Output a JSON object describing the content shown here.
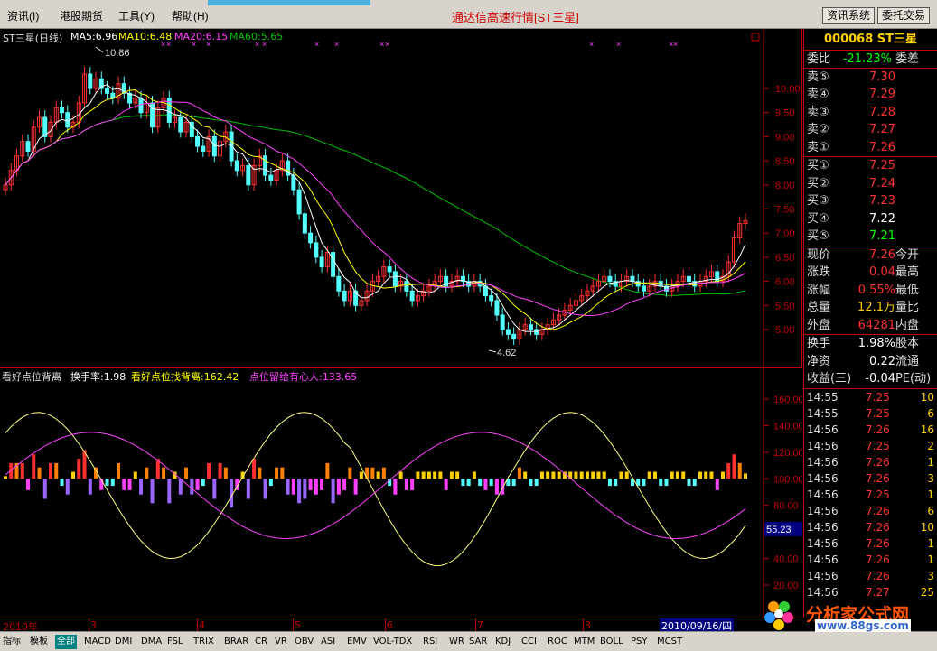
{
  "menubar": {
    "items": [
      "资讯(I)",
      "港股期货",
      "工具(Y)",
      "帮助(H)"
    ],
    "title": "通达信高速行情[ST三星]",
    "btn_news": "资讯系统",
    "btn_trade": "委托交易"
  },
  "main": {
    "legend": {
      "name": "ST三星(日线)",
      "ma5": "MA5:6.96",
      "ma10": "MA10:6.48",
      "ma20": "MA20:6.15",
      "ma60": "MA60:5.65"
    },
    "high_label": "10.86",
    "low_label": "4.62",
    "y_ticks": [
      "10.00",
      "9.50",
      "9.00",
      "8.50",
      "8.00",
      "7.50",
      "7.00",
      "6.50",
      "6.00",
      "5.50",
      "5.00"
    ]
  },
  "indicator": {
    "legend_name": "看好点位背离",
    "legend_turnover": "换手率:1.98",
    "legend_a": "看好点位找背离:162.42",
    "legend_b": "点位留给有心人:133.65",
    "y_ticks": [
      "160.00",
      "140.00",
      "120.00",
      "100.00",
      "80.00",
      "60.00",
      "40.00",
      "20.00"
    ],
    "cursor_value": "55.23"
  },
  "quote": {
    "header": "000068 ST三星",
    "ratio_label": "委比",
    "ratio_value": "-21.23%",
    "ratio_right": "委差",
    "asks": [
      {
        "label": "卖⑤",
        "price": "7.30"
      },
      {
        "label": "卖④",
        "price": "7.29"
      },
      {
        "label": "卖③",
        "price": "7.28"
      },
      {
        "label": "卖②",
        "price": "7.27"
      },
      {
        "label": "卖①",
        "price": "7.26"
      }
    ],
    "bids": [
      {
        "label": "买①",
        "price": "7.25"
      },
      {
        "label": "买②",
        "price": "7.24"
      },
      {
        "label": "买③",
        "price": "7.23"
      },
      {
        "label": "买④",
        "price": "7.22"
      },
      {
        "label": "买⑤",
        "price": "7.21"
      }
    ],
    "stats": [
      {
        "label": "现价",
        "value": "7.26",
        "right": "今开"
      },
      {
        "label": "涨跌",
        "value": "0.04",
        "right": "最高"
      },
      {
        "label": "涨幅",
        "value": "0.55%",
        "right": "最低"
      },
      {
        "label": "总量",
        "value": "12.1万",
        "right": "量比"
      },
      {
        "label": "外盘",
        "value": "64281",
        "right": "内盘"
      }
    ],
    "finance": [
      {
        "label": "换手",
        "value": "1.98%",
        "right": "股本"
      },
      {
        "label": "净资",
        "value": "0.22",
        "right": "流通"
      },
      {
        "label": "收益(三)",
        "value": "-0.04",
        "right": "PE(动)"
      }
    ],
    "ticks": [
      {
        "time": "14:55",
        "price": "7.25",
        "vol": "10"
      },
      {
        "time": "14:55",
        "price": "7.25",
        "vol": "6"
      },
      {
        "time": "14:56",
        "price": "7.26",
        "vol": "16"
      },
      {
        "time": "14:56",
        "price": "7.25",
        "vol": "2"
      },
      {
        "time": "14:56",
        "price": "7.26",
        "vol": "1"
      },
      {
        "time": "14:56",
        "price": "7.26",
        "vol": "3"
      },
      {
        "time": "14:56",
        "price": "7.25",
        "vol": "1"
      },
      {
        "time": "14:56",
        "price": "7.26",
        "vol": "6"
      },
      {
        "time": "14:56",
        "price": "7.26",
        "vol": "10"
      },
      {
        "time": "14:56",
        "price": "7.26",
        "vol": "1"
      },
      {
        "time": "14:56",
        "price": "7.26",
        "vol": "1"
      },
      {
        "time": "14:56",
        "price": "7.26",
        "vol": "3"
      },
      {
        "time": "14:56",
        "price": "7.27",
        "vol": "25"
      }
    ]
  },
  "date_bar": {
    "year": "2010年",
    "months": [
      "3",
      "4",
      "5",
      "6",
      "7",
      "8"
    ],
    "cursor_date": "2010/09/16/四"
  },
  "tabs": [
    "指标",
    "模板",
    "全部",
    "MACD",
    "DMI",
    "DMA",
    "FSL",
    "TRIX",
    "BRAR",
    "CR",
    "VR",
    "OBV",
    "ASI",
    "EMV",
    "VOL-TDX",
    "RSI",
    "WR",
    "SAR",
    "KDJ",
    "CCI",
    "ROC",
    "MTM",
    "BOLL",
    "PSY",
    "MCST"
  ],
  "watermark": {
    "line1": "分析家公式网",
    "line2": "www.88gs.com"
  },
  "colors": {
    "up": "#ff3030",
    "down": "#54ffff",
    "ma5": "#ffffff",
    "ma10": "#ffff00",
    "ma20": "#ff40ff",
    "ma60": "#00c000",
    "grid_red": "#c00000"
  }
}
